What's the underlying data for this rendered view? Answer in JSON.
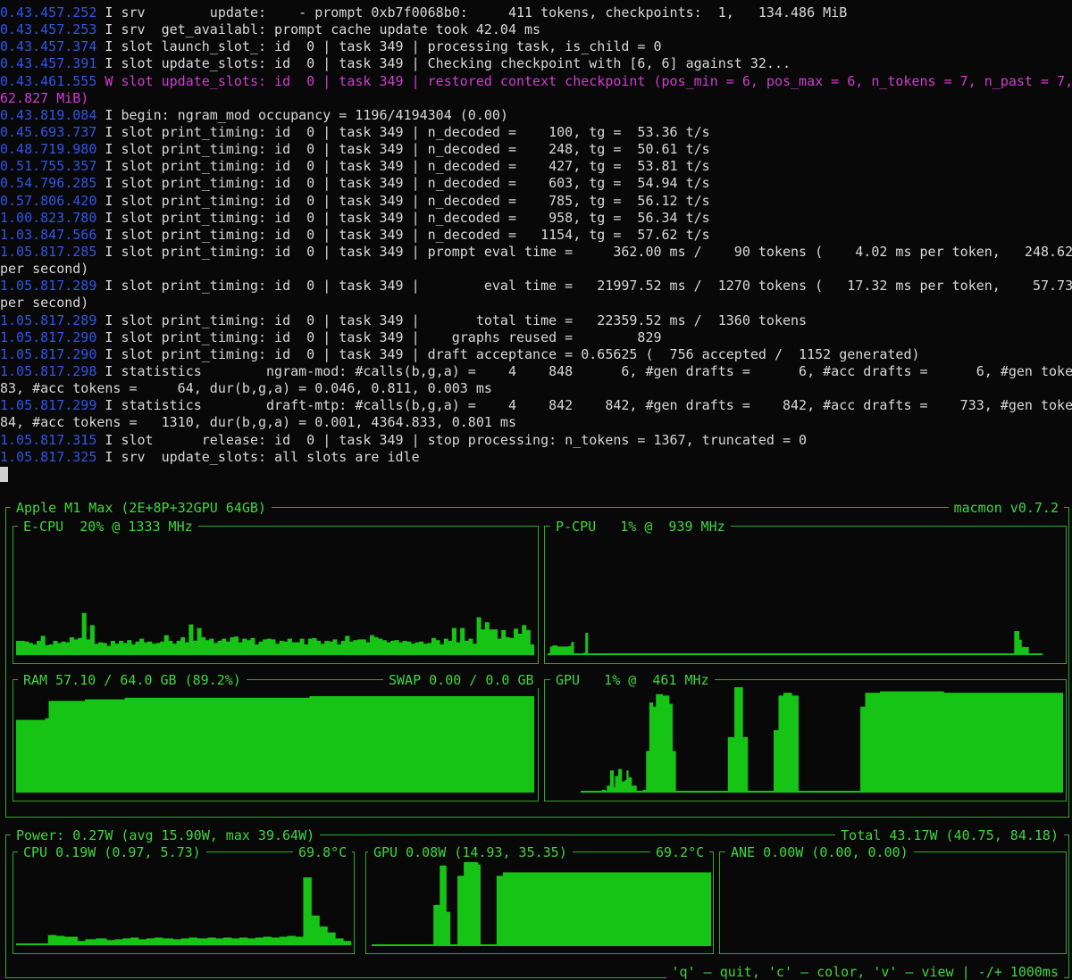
{
  "log_lines": [
    {
      "ts": "0.43.457.252",
      "lvl": "I",
      "msg": " srv        update:    - prompt 0xb7f0068b0:     411 tokens, checkpoints:  1,   134.486 MiB"
    },
    {
      "ts": "0.43.457.253",
      "lvl": "I",
      "msg": " srv  get_availabl: prompt cache update took 42.04 ms"
    },
    {
      "ts": "0.43.457.374",
      "lvl": "I",
      "msg": " slot launch_slot_: id  0 | task 349 | processing task, is_child = 0"
    },
    {
      "ts": "0.43.457.391",
      "lvl": "I",
      "msg": " slot update_slots: id  0 | task 349 | Checking checkpoint with [6, 6] against 32..."
    },
    {
      "ts": "0.43.461.555",
      "lvl": "W",
      "msg": " slot update_slots: id  0 | task 349 | restored context checkpoint (pos_min = 6, pos_max = 6, n_tokens = 7, n_past = 7, size =",
      "warn": true
    },
    {
      "ts": "",
      "lvl": "",
      "msg": "62.827 MiB)",
      "warn": true
    },
    {
      "ts": "0.43.819.084",
      "lvl": "I",
      "msg": " begin: ngram_mod occupancy = 1196/4194304 (0.00)"
    },
    {
      "ts": "0.45.693.737",
      "lvl": "I",
      "msg": " slot print_timing: id  0 | task 349 | n_decoded =    100, tg =  53.36 t/s"
    },
    {
      "ts": "0.48.719.980",
      "lvl": "I",
      "msg": " slot print_timing: id  0 | task 349 | n_decoded =    248, tg =  50.61 t/s"
    },
    {
      "ts": "0.51.755.357",
      "lvl": "I",
      "msg": " slot print_timing: id  0 | task 349 | n_decoded =    427, tg =  53.81 t/s"
    },
    {
      "ts": "0.54.796.285",
      "lvl": "I",
      "msg": " slot print_timing: id  0 | task 349 | n_decoded =    603, tg =  54.94 t/s"
    },
    {
      "ts": "0.57.806.420",
      "lvl": "I",
      "msg": " slot print_timing: id  0 | task 349 | n_decoded =    785, tg =  56.12 t/s"
    },
    {
      "ts": "1.00.823.780",
      "lvl": "I",
      "msg": " slot print_timing: id  0 | task 349 | n_decoded =    958, tg =  56.34 t/s"
    },
    {
      "ts": "1.03.847.566",
      "lvl": "I",
      "msg": " slot print_timing: id  0 | task 349 | n_decoded =   1154, tg =  57.62 t/s"
    },
    {
      "ts": "1.05.817.285",
      "lvl": "I",
      "msg": " slot print_timing: id  0 | task 349 | prompt eval time =     362.00 ms /    90 tokens (    4.02 ms per token,   248.62 tokens"
    },
    {
      "ts": "",
      "lvl": "",
      "msg": "per second)"
    },
    {
      "ts": "1.05.817.289",
      "lvl": "I",
      "msg": " slot print_timing: id  0 | task 349 |        eval time =   21997.52 ms /  1270 tokens (   17.32 ms per token,    57.73 tokens"
    },
    {
      "ts": "",
      "lvl": "",
      "msg": "per second)"
    },
    {
      "ts": "1.05.817.289",
      "lvl": "I",
      "msg": " slot print_timing: id  0 | task 349 |       total time =   22359.52 ms /  1360 tokens"
    },
    {
      "ts": "1.05.817.290",
      "lvl": "I",
      "msg": " slot print_timing: id  0 | task 349 |    graphs reused =        829"
    },
    {
      "ts": "1.05.817.290",
      "lvl": "I",
      "msg": " slot print_timing: id  0 | task 349 | draft acceptance = 0.65625 (  756 accepted /  1152 generated)"
    },
    {
      "ts": "1.05.817.298",
      "lvl": "I",
      "msg": " statistics        ngram-mod: #calls(b,g,a) =    4    848      6, #gen drafts =      6, #acc drafts =      6, #gen tokens =    3"
    },
    {
      "ts": "",
      "lvl": "",
      "msg": "83, #acc tokens =     64, dur(b,g,a) = 0.046, 0.811, 0.003 ms"
    },
    {
      "ts": "1.05.817.299",
      "lvl": "I",
      "msg": " statistics        draft-mtp: #calls(b,g,a) =    4    842    842, #gen drafts =    842, #acc drafts =    733, #gen tokens =   16"
    },
    {
      "ts": "",
      "lvl": "",
      "msg": "84, #acc tokens =   1310, dur(b,g,a) = 0.001, 4364.833, 0.801 ms"
    },
    {
      "ts": "1.05.817.315",
      "lvl": "I",
      "msg": " slot      release: id  0 | task 349 | stop processing: n_tokens = 1367, truncated = 0"
    },
    {
      "ts": "1.05.817.325",
      "lvl": "I",
      "msg": " srv  update_slots: all slots are idle"
    }
  ],
  "monitor": {
    "colors": {
      "accent": "#3fd63f",
      "bar": "#16c416",
      "border": "#2ba82b"
    },
    "header": {
      "left": "Apple M1 Max (2E+8P+32GPU 64GB)",
      "right": "macmon v0.7.2"
    },
    "ecpu": {
      "label": "E-CPU  20% @ 1333 MHz",
      "percent": 20,
      "freq_mhz": 1333,
      "history": [
        20,
        20,
        19,
        17,
        15,
        20,
        27,
        14,
        15,
        20,
        17,
        19,
        18,
        25,
        22,
        24,
        59,
        22,
        42,
        16,
        18,
        17,
        13,
        20,
        16,
        20,
        17,
        21,
        15,
        19,
        23,
        18,
        19,
        16,
        17,
        19,
        28,
        20,
        16,
        20,
        25,
        18,
        43,
        20,
        38,
        25,
        21,
        23,
        17,
        20,
        23,
        19,
        25,
        26,
        18,
        23,
        21,
        24,
        15,
        19,
        22,
        23,
        22,
        16,
        20,
        19,
        23,
        18,
        18,
        23,
        15,
        23,
        24,
        20,
        16,
        20,
        19,
        22,
        15,
        20,
        27,
        19,
        21,
        22,
        22,
        18,
        28,
        25,
        23,
        21,
        18,
        20,
        21,
        18,
        20,
        19,
        16,
        18,
        19,
        16,
        17,
        24,
        21,
        15,
        23,
        20,
        38,
        18,
        38,
        20,
        23,
        16,
        53,
        36,
        46,
        36,
        36,
        23,
        35,
        25,
        24,
        37,
        30,
        42,
        35,
        15
      ]
    },
    "pcpu": {
      "label": "P-CPU   1% @  939 MHz",
      "percent": 1,
      "freq_mhz": 939,
      "history": [
        3,
        15,
        17,
        17,
        15,
        15,
        15,
        15,
        15,
        16,
        23,
        0,
        0,
        0,
        0,
        4,
        39,
        0,
        2,
        0,
        0,
        0,
        0,
        2,
        0,
        0,
        1,
        0,
        0,
        0,
        0,
        2,
        0,
        2,
        0,
        0,
        0,
        0,
        0,
        0,
        0,
        0,
        0,
        0,
        0,
        0,
        0,
        0,
        0,
        0,
        0,
        0,
        0,
        0,
        0,
        0,
        0,
        0,
        0,
        0,
        0,
        1,
        1,
        1,
        1,
        1,
        1,
        0,
        0,
        0,
        0,
        0,
        0,
        2,
        2,
        0,
        0,
        0,
        0,
        0,
        1,
        1,
        1,
        1,
        1,
        0,
        0,
        1,
        1,
        1,
        1,
        1,
        1,
        1,
        0,
        1,
        1,
        1,
        1,
        1,
        1,
        1,
        0,
        0,
        0,
        0,
        0,
        0,
        0,
        0,
        0,
        0,
        0,
        0,
        0,
        0,
        0,
        0,
        0,
        0,
        0,
        0,
        0,
        0,
        0,
        0,
        0,
        0,
        0,
        0,
        0,
        0,
        0,
        0,
        1,
        1,
        1,
        1,
        1,
        1,
        0,
        0,
        0,
        0,
        1,
        1,
        1,
        1,
        1,
        1,
        1,
        1,
        2,
        2,
        2,
        2,
        2,
        2,
        2,
        2,
        2,
        2,
        2,
        2,
        2,
        2,
        2,
        2,
        2,
        2,
        2,
        2,
        0,
        0,
        0,
        0,
        0,
        1,
        1,
        1,
        1,
        1,
        1,
        1,
        1,
        1,
        1,
        1,
        0,
        0,
        0,
        0,
        0,
        0,
        0,
        0,
        2,
        2,
        42,
        42,
        27,
        14,
        14,
        14,
        0,
        0,
        0,
        0,
        0,
        0,
        0,
        0,
        0,
        0,
        0,
        0,
        0
      ]
    },
    "ram": {
      "label": "RAM 57.10 / 64.0 GB (89.2%)",
      "swap": "SWAP 0.00 / 0.0 GB",
      "percent": 89.2,
      "history": [
        46,
        46,
        46,
        46,
        46,
        46,
        46,
        46,
        47,
        58,
        58,
        58,
        58,
        58,
        58,
        58,
        58,
        58,
        58,
        59,
        59,
        59,
        59,
        59,
        59,
        59,
        59,
        59,
        59,
        59,
        60,
        60,
        60,
        60,
        60,
        60,
        60,
        60,
        60,
        60,
        60,
        60,
        60,
        60,
        60,
        60,
        60,
        60,
        60,
        60,
        60,
        60,
        60,
        60,
        60,
        60,
        60,
        60,
        60,
        60,
        60,
        60,
        60,
        60,
        60,
        60,
        60,
        60,
        60,
        60,
        60,
        60,
        60,
        60,
        60,
        60,
        60,
        60,
        60,
        60,
        60,
        61,
        61,
        61,
        61,
        61,
        61,
        61,
        61,
        61,
        61,
        61,
        61,
        61,
        61,
        61,
        61,
        61,
        61,
        61,
        61,
        61,
        61,
        61,
        61,
        61,
        61,
        61,
        61,
        61,
        61,
        61,
        61,
        61,
        61,
        61,
        61,
        61,
        61,
        61,
        61,
        61,
        61,
        61,
        61,
        61,
        61,
        61,
        61,
        61,
        61,
        61,
        61,
        61,
        61,
        61,
        61,
        61,
        61,
        61,
        61,
        61,
        61
      ]
    },
    "gpu": {
      "label": "GPU   1% @  461 MHz",
      "percent": 1,
      "freq_mhz": 461,
      "history": [
        0,
        0,
        0,
        0,
        0,
        0,
        0,
        0,
        0,
        0,
        0,
        0,
        0,
        2,
        2,
        0,
        5,
        5,
        16,
        16,
        4,
        12,
        12,
        17,
        17,
        8,
        8,
        9,
        16,
        11,
        11,
        5,
        5,
        5,
        0,
        0,
        0,
        0,
        2,
        2,
        30,
        30,
        65,
        65,
        62,
        62,
        71,
        71,
        71,
        71,
        70,
        70,
        70,
        70,
        64,
        64,
        30,
        30,
        0,
        0,
        0,
        0,
        0,
        0,
        0,
        0,
        0,
        0,
        0,
        0,
        0,
        0,
        0,
        0,
        0,
        0,
        0,
        0,
        0,
        0,
        0,
        0,
        0,
        0,
        0,
        0,
        0,
        0,
        0,
        0,
        40,
        40,
        40,
        40,
        76,
        76,
        76,
        76,
        76,
        40,
        40,
        40,
        0,
        0,
        0,
        0,
        0,
        0,
        0,
        0,
        0,
        0,
        0,
        0,
        0,
        0,
        0,
        0,
        45,
        45,
        45,
        70,
        70,
        70,
        72,
        72,
        72,
        72,
        72,
        70,
        70,
        70,
        70,
        0,
        0,
        0,
        0,
        0,
        0,
        0,
        0,
        0,
        0,
        0,
        0,
        0,
        0,
        0,
        0,
        0,
        0,
        0,
        0,
        0,
        0,
        0,
        0,
        0,
        0,
        0,
        0,
        0,
        0,
        0,
        0,
        0,
        0,
        0,
        0,
        0,
        0,
        62,
        62,
        62,
        72,
        72,
        72,
        72,
        72,
        72,
        72,
        72,
        72,
        73,
        73,
        73,
        73,
        73,
        73,
        73,
        73,
        73,
        73,
        73,
        73,
        73,
        73,
        73,
        73,
        73,
        73,
        73,
        73,
        73,
        73,
        73,
        73,
        73,
        73,
        73,
        73,
        73,
        73,
        73,
        73,
        73,
        73,
        73,
        73,
        73,
        73,
        73,
        72,
        72,
        72,
        72,
        72,
        72,
        72,
        72,
        72,
        72,
        72,
        72,
        72,
        72,
        72,
        72,
        72,
        72,
        72,
        72,
        72,
        72,
        72,
        72,
        72,
        72,
        72,
        72,
        72,
        72,
        72,
        72,
        72,
        72,
        72,
        72,
        72,
        72,
        72,
        72,
        72,
        72,
        72,
        72,
        72,
        72,
        72,
        72,
        72,
        72,
        72,
        72,
        72,
        72,
        72,
        72,
        72,
        72,
        72,
        72,
        72,
        72,
        72,
        72,
        72,
        72,
        72,
        72,
        72,
        72,
        72,
        72,
        72,
        72,
        72,
        72,
        72,
        72,
        72,
        72,
        72,
        72,
        72,
        72,
        72,
        72,
        72,
        72,
        72,
        72,
        72,
        72,
        72,
        72,
        72,
        72,
        72,
        72,
        72,
        72,
        72,
        72,
        72,
        72,
        72,
        72,
        72,
        72,
        72,
        72,
        64,
        64,
        64,
        64,
        64,
        2,
        2,
        2,
        2,
        2
      ]
    }
  },
  "power": {
    "header": {
      "left": "Power: 0.27W (avg 15.90W, max 39.64W)",
      "right": "Total 43.17W (40.75, 84.18)"
    },
    "cpu": {
      "label": "CPU 0.19W (0.97, 5.73)",
      "temp": "69.8°C",
      "history": [
        2,
        2,
        2,
        2,
        2,
        2,
        2,
        2,
        2,
        2,
        2,
        2,
        2,
        2,
        2,
        2,
        2,
        2,
        0,
        0,
        0,
        0,
        0,
        0,
        0,
        0,
        0,
        0,
        0,
        0,
        0,
        0,
        0,
        0,
        0,
        0,
        0,
        0,
        0,
        0,
        0,
        0,
        0,
        0,
        0,
        0,
        0,
        0,
        0,
        0,
        0,
        0,
        0,
        0,
        0,
        0,
        0,
        0,
        0,
        0,
        0,
        0,
        0,
        0,
        0,
        0,
        0,
        0,
        0,
        0,
        0,
        0,
        0,
        0,
        0,
        0,
        0,
        0,
        0,
        0,
        0,
        0,
        0,
        0,
        0,
        0,
        0,
        0,
        0,
        0,
        0,
        0,
        0,
        0,
        0,
        0,
        0,
        0,
        0,
        0,
        0,
        0,
        0,
        0,
        0,
        0,
        0,
        0,
        0,
        0,
        0,
        0,
        0,
        0,
        0,
        0,
        0,
        0,
        0,
        0,
        0,
        0,
        0,
        0,
        0,
        0,
        0,
        0,
        0,
        0,
        0,
        0,
        0,
        0,
        0,
        0,
        0,
        0,
        0,
        0,
        0,
        0,
        0,
        0,
        0,
        0,
        0,
        0,
        0,
        0,
        0,
        0,
        0,
        0,
        0,
        0,
        0,
        0,
        0,
        0,
        0,
        0,
        0,
        0,
        0,
        0,
        0,
        0,
        0,
        0,
        0,
        0,
        0,
        0,
        0,
        0,
        0,
        0,
        0,
        0,
        0,
        0,
        0,
        0,
        0,
        0,
        0,
        0,
        0,
        0,
        0,
        0,
        0,
        0,
        0,
        0,
        0,
        0,
        0,
        0,
        0,
        0,
        0,
        0,
        0,
        0,
        0,
        0,
        0,
        0,
        0,
        0,
        0,
        0,
        0,
        0,
        0,
        0,
        0,
        0,
        0,
        0,
        0,
        0,
        0,
        0,
        0,
        0,
        0,
        0,
        0,
        0,
        0,
        0,
        0,
        0,
        0,
        0,
        0,
        0,
        0,
        0,
        0,
        0,
        0,
        0,
        0,
        0,
        0,
        0,
        0,
        0,
        0,
        0,
        0,
        0,
        0,
        0,
        0,
        0,
        0,
        0,
        0,
        0,
        0,
        0,
        0,
        0,
        0,
        0,
        0,
        0,
        0,
        0,
        0,
        0,
        0,
        0,
        0,
        0,
        0,
        0,
        0,
        0,
        0,
        0,
        0,
        0,
        0,
        0,
        0,
        0,
        0,
        0,
        0,
        0,
        0,
        0,
        0,
        0,
        0,
        0,
        0,
        0,
        0,
        0,
        0,
        0,
        0,
        0,
        0,
        0,
        0,
        0,
        0,
        0,
        0,
        0,
        0,
        0,
        0,
        0,
        0,
        0,
        0,
        0,
        0,
        0,
        0,
        0,
        0,
        0,
        0,
        0,
        0,
        0,
        0,
        0,
        0,
        0,
        0,
        0,
        0,
        0,
        0,
        0,
        0,
        0,
        0,
        0,
        0,
        0,
        0,
        0,
        0,
        0,
        0,
        0,
        0,
        0,
        0,
        0,
        0,
        0,
        0,
        0,
        0,
        0,
        0,
        0,
        0,
        0,
        0,
        0,
        0,
        0,
        0,
        0,
        0,
        0,
        0,
        0,
        0
      ]
    },
    "gpu": {
      "label": "GPU 0.08W (14.93, 35.35)",
      "temp": "69.2°C",
      "history": []
    },
    "ane": {
      "label": "ANE 0.00W (0.00, 0.00)",
      "history": []
    }
  },
  "footer": {
    "keys": "'q' – quit, 'c' – color, 'v' – view | -/+ 1000ms"
  }
}
